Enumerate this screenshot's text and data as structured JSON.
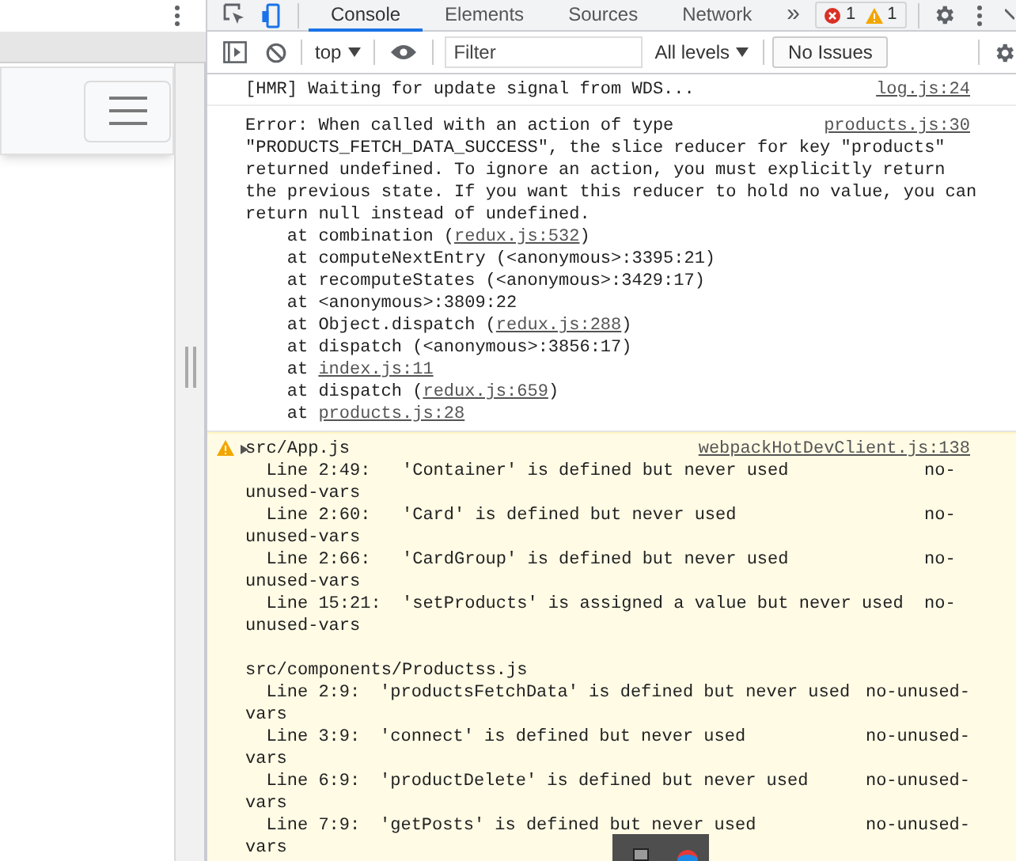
{
  "devtools": {
    "tabs": [
      {
        "label": "Console",
        "selected": true
      },
      {
        "label": "Elements",
        "selected": false
      },
      {
        "label": "Sources",
        "selected": false
      },
      {
        "label": "Network",
        "selected": false
      }
    ],
    "overflow": "»",
    "error_count": "1",
    "warning_count": "1"
  },
  "toolbar": {
    "context": "top",
    "filter_placeholder": "Filter",
    "levels": "All levels",
    "issues": "No Issues"
  },
  "messages": [
    {
      "kind": "log",
      "text": "[HMR] Waiting for update signal from WDS...",
      "source": "log.js:24"
    },
    {
      "kind": "error",
      "first_line": "Error: When called with an action of type",
      "source": "products.js:30",
      "lines": [
        "\"PRODUCTS_FETCH_DATA_SUCCESS\", the slice reducer for key \"products\"",
        "returned undefined. To ignore an action, you must explicitly return",
        "the previous state. If you want this reducer to hold no value, you can",
        "return null instead of undefined."
      ],
      "stack": [
        {
          "before": "at combination (",
          "link": "redux.js:532",
          "after": ")"
        },
        {
          "before": "at computeNextEntry (<anonymous>:3395:21)"
        },
        {
          "before": "at recomputeStates (<anonymous>:3429:17)"
        },
        {
          "before": "at <anonymous>:3809:22"
        },
        {
          "before": "at Object.dispatch (",
          "link": "redux.js:288",
          "after": ")"
        },
        {
          "before": "at dispatch (<anonymous>:3856:17)"
        },
        {
          "before": "at ",
          "link": "index.js:11"
        },
        {
          "before": "at dispatch (",
          "link": "redux.js:659",
          "after": ")"
        },
        {
          "before": "at ",
          "link": "products.js:28"
        }
      ]
    },
    {
      "kind": "warning",
      "expanded": false,
      "source": "webpackHotDevClient.js:138",
      "groups": [
        {
          "file": "src/App.js",
          "items": [
            {
              "line": "Line 2:49:",
              "message": "'Container' is defined but never used",
              "rule": "no-",
              "rule_rest": "unused-vars"
            },
            {
              "line": "Line 2:60:",
              "message": "'Card' is defined but never used",
              "rule": "no-",
              "rule_rest": "unused-vars"
            },
            {
              "line": "Line 2:66:",
              "message": "'CardGroup' is defined but never used",
              "rule": "no-",
              "rule_rest": "unused-vars"
            },
            {
              "line": "Line 15:21:",
              "message": "'setProducts' is assigned a value but never used",
              "rule": "no-",
              "rule_rest": "unused-vars"
            }
          ]
        },
        {
          "file": "src/components/Productss.js",
          "items": [
            {
              "line": "Line 2:9:",
              "message": "'productsFetchData' is defined but never used",
              "rule": "no-unused-",
              "rule_rest": "vars"
            },
            {
              "line": "Line 3:9:",
              "message": "'connect' is defined but never used",
              "rule": "no-unused-",
              "rule_rest": "vars"
            },
            {
              "line": "Line 6:9:",
              "message": "'productDelete' is defined but never used",
              "rule": "no-unused-",
              "rule_rest": "vars"
            },
            {
              "line": "Line 7:9:",
              "message": "'getPosts' is defined but never used",
              "rule": "no-unused-",
              "rule_rest": "vars"
            }
          ]
        }
      ]
    }
  ]
}
